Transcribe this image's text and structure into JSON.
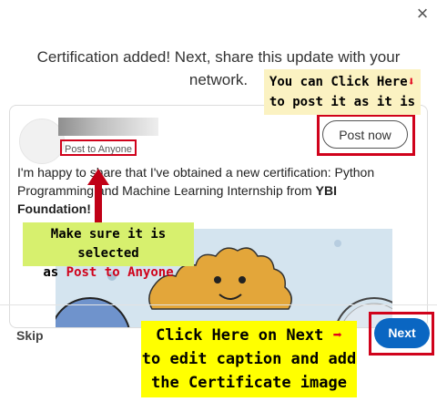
{
  "dialog": {
    "close_label": "×",
    "headline_line1": "Certification added! Next, share this update with your",
    "headline_line2": "network."
  },
  "post": {
    "visibility": "Post to Anyone",
    "post_now_label": "Post now",
    "text_line1": "I'm happy to share that I've obtained a new certification: Python",
    "text_line2": "Programming and Machine Learning Internship from ",
    "text_org1": "YBI",
    "text_org2": "Foundation!"
  },
  "footer": {
    "skip_label": "Skip",
    "next_label": "Next"
  },
  "annotations": {
    "post_now_hint_line1": "You can Click Here",
    "post_now_hint_line2": "to post it as it is",
    "visibility_hint_line1": "Make sure it is selected",
    "visibility_hint_prefix": "as ",
    "visibility_hint_emph": "Post to Anyone",
    "next_hint_line1": "Click Here on Next",
    "next_hint_line2": "to edit caption and add",
    "next_hint_line3": "the Certificate image"
  },
  "colors": {
    "primary_button": "#0a66c2",
    "highlight_frame": "#d0021b",
    "callout_yellow": "#ffff00",
    "callout_green": "#d7f06e",
    "callout_cream": "#fbf2c2"
  }
}
